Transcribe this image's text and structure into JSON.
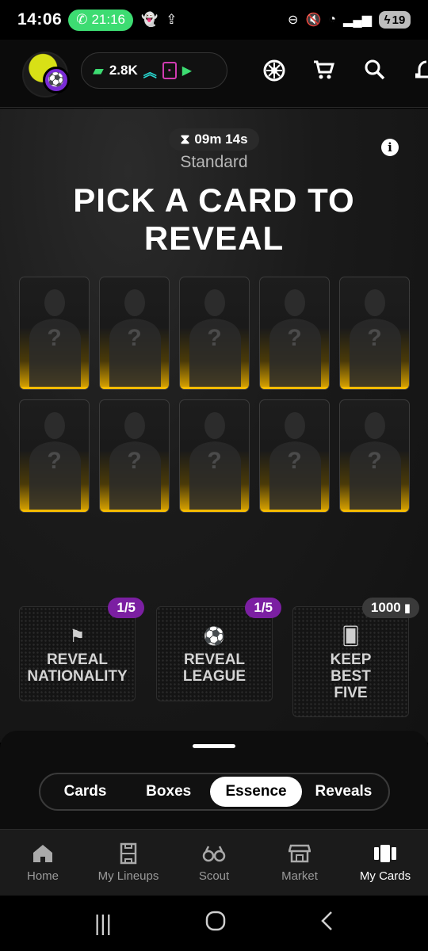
{
  "status": {
    "time": "14:06",
    "call_time": "21:16",
    "battery": "19"
  },
  "header": {
    "balance": "2.8K",
    "icons": [
      "cash-icon",
      "chevrons-up-icon",
      "card-icon",
      "play-icon",
      "wheel-icon",
      "cart-icon",
      "search-icon",
      "bell-icon"
    ]
  },
  "reveal": {
    "timer": "09m 14s",
    "subtitle": "Standard",
    "title": "PICK A CARD TO\nREVEAL",
    "cards": [
      "?",
      "?",
      "?",
      "?",
      "?",
      "?",
      "?",
      "?",
      "?",
      "?"
    ]
  },
  "actions": [
    {
      "label": "REVEAL\nNATIONALITY",
      "badge": "1/5",
      "icon": "flag-icon"
    },
    {
      "label": "REVEAL\nLEAGUE",
      "badge": "1/5",
      "icon": "ball-icon"
    },
    {
      "label": "KEEP\nBEST\nFIVE",
      "badge": "1000",
      "icon": "cards-icon"
    }
  ],
  "sheet": {
    "tabs": [
      "Cards",
      "Boxes",
      "Essence",
      "Reveals"
    ],
    "active_tab": "Essence"
  },
  "nav": {
    "items": [
      "Home",
      "My Lineups",
      "Scout",
      "Market",
      "My Cards"
    ],
    "active": "My Cards"
  },
  "colors": {
    "accent_gold": "#f5bb00",
    "badge_purple": "#7b1fa2",
    "call_green": "#3ddc72"
  }
}
